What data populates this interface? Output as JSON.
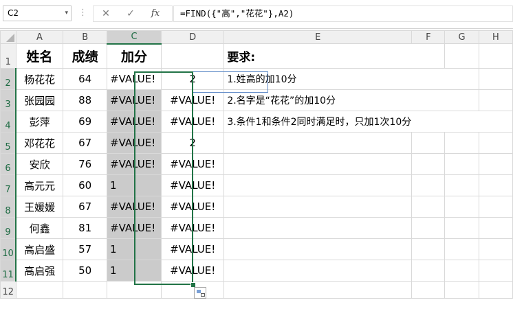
{
  "formula_bar": {
    "name_box": "C2",
    "name_box_dropdown": "▾",
    "more_icon": "⋮",
    "cancel_icon": "✕",
    "enter_icon": "✓",
    "fx_label": "fx",
    "formula": "=FIND({\"高\",\"花花\"},A2)"
  },
  "columns": [
    "A",
    "B",
    "C",
    "D",
    "E",
    "F",
    "G",
    "H"
  ],
  "rows": [
    {
      "num": "1",
      "a": "姓名",
      "b": "成绩",
      "c": "加分",
      "d": "",
      "e": "要求:"
    },
    {
      "num": "2",
      "a": "杨花花",
      "b": "64",
      "c": "#VALUE!",
      "d": "2",
      "e": "1.姓高的加10分"
    },
    {
      "num": "3",
      "a": "张园园",
      "b": "88",
      "c": "#VALUE!",
      "d": "#VALUE!",
      "e": "2.名字是“花花”的加10分"
    },
    {
      "num": "4",
      "a": "彭萍",
      "b": "69",
      "c": "#VALUE!",
      "d": "#VALUE!",
      "e": "3.条件1和条件2同时满足时，只加1次10分"
    },
    {
      "num": "5",
      "a": "邓花花",
      "b": "67",
      "c": "#VALUE!",
      "d": "2",
      "e": ""
    },
    {
      "num": "6",
      "a": "安欣",
      "b": "76",
      "c": "#VALUE!",
      "d": "#VALUE!",
      "e": ""
    },
    {
      "num": "7",
      "a": "高元元",
      "b": "60",
      "c": "1",
      "d": "#VALUE!",
      "e": ""
    },
    {
      "num": "8",
      "a": "王媛媛",
      "b": "67",
      "c": "#VALUE!",
      "d": "#VALUE!",
      "e": ""
    },
    {
      "num": "9",
      "a": "何鑫",
      "b": "81",
      "c": "#VALUE!",
      "d": "#VALUE!",
      "e": ""
    },
    {
      "num": "10",
      "a": "高启盛",
      "b": "57",
      "c": "1",
      "d": "#VALUE!",
      "e": ""
    },
    {
      "num": "11",
      "a": "高启强",
      "b": "50",
      "c": "1",
      "d": "#VALUE!",
      "e": ""
    },
    {
      "num": "12",
      "a": "",
      "b": "",
      "c": "",
      "d": "",
      "e": ""
    }
  ],
  "colors": {
    "selection_border": "#217346",
    "selection_fill": "#cbcbcb",
    "header_fill": "#f0f0f0"
  }
}
